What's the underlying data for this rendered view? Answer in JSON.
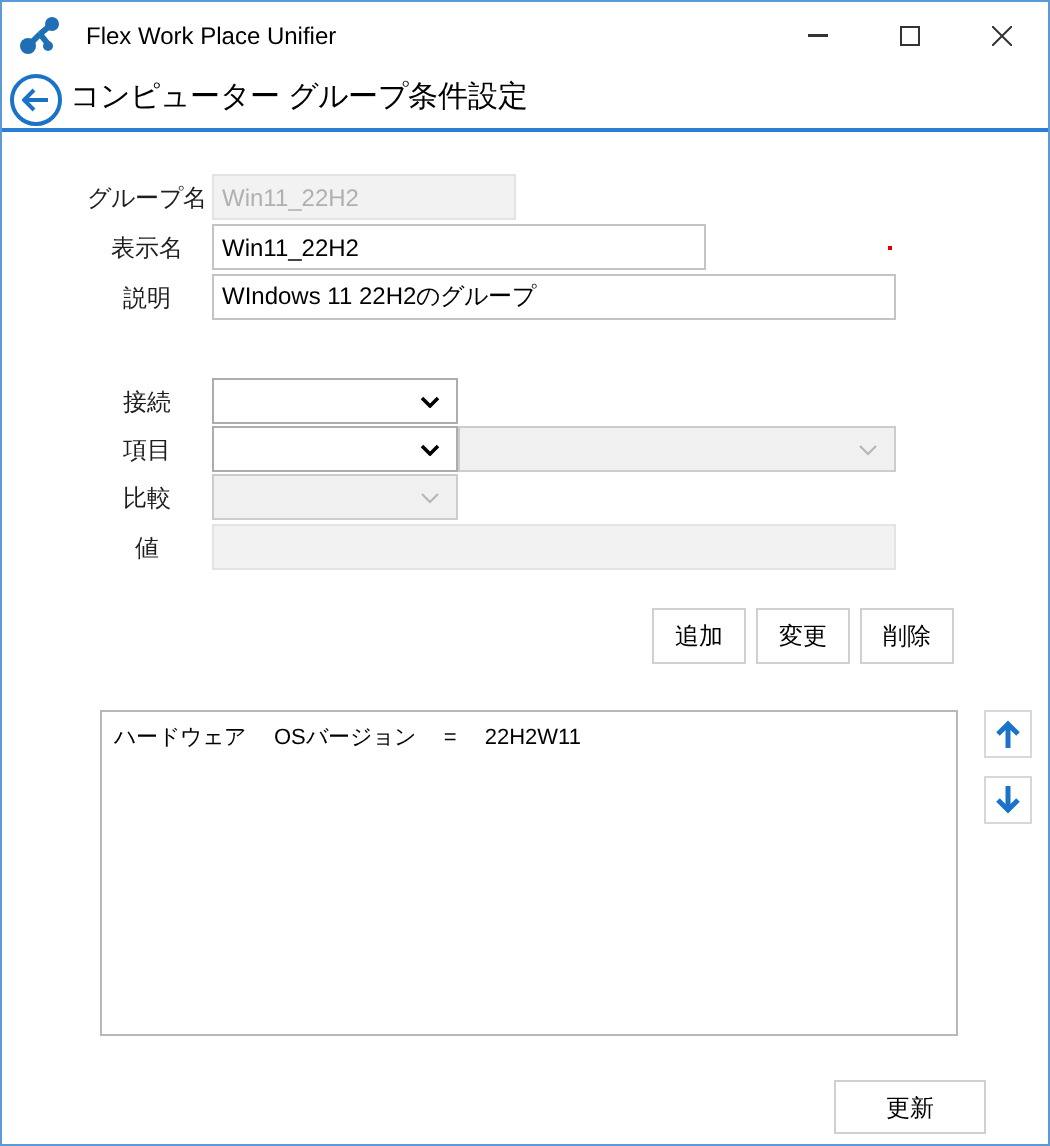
{
  "window": {
    "title": "Flex Work Place Unifier"
  },
  "header": {
    "title": "コンピューター グループ条件設定"
  },
  "group": {
    "name": {
      "label": "グループ名",
      "value": "Win11_22H2",
      "disabled": true
    },
    "display_name": {
      "label": "表示名",
      "value": "Win11_22H2",
      "required": true
    },
    "description": {
      "label": "説明",
      "value": "WIndows 11 22H2のグループ"
    }
  },
  "condition": {
    "connection": {
      "label": "接続",
      "disabled": false
    },
    "item": {
      "label": "項目",
      "disabled": false,
      "detail_disabled": true
    },
    "compare": {
      "label": "比較",
      "disabled": true
    },
    "value": {
      "label": "値",
      "disabled": true
    }
  },
  "actions": [
    "追加",
    "変更",
    "削除"
  ],
  "conditions_list": [
    {
      "category": "ハードウェア",
      "item": "OSバージョン",
      "operator": "=",
      "value": "22H2W11"
    }
  ],
  "update_button": "更新"
}
